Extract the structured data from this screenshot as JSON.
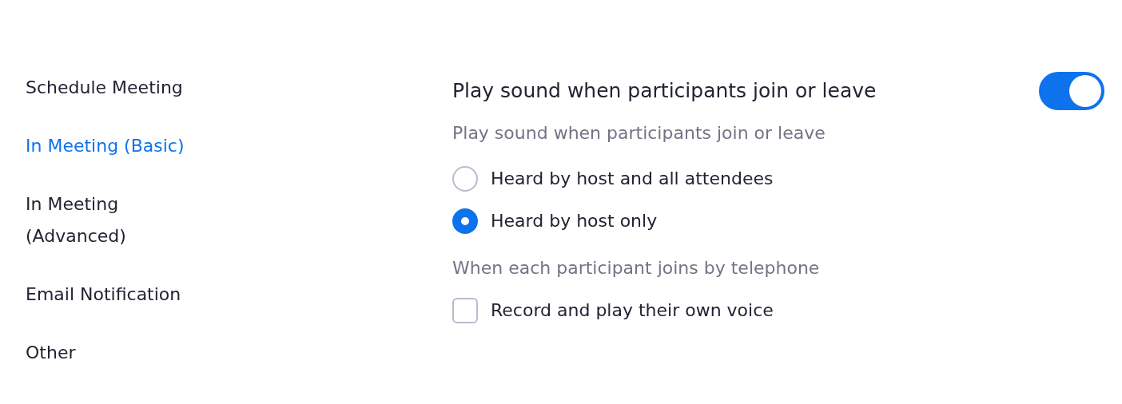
{
  "sidebar": {
    "items": [
      {
        "label": "Schedule Meeting",
        "selected": false
      },
      {
        "label": "In Meeting (Basic)",
        "selected": true
      },
      {
        "label": "In Meeting\n(Advanced)",
        "selected": false
      },
      {
        "label": "Email Notification",
        "selected": false
      },
      {
        "label": "Other",
        "selected": false
      }
    ]
  },
  "setting": {
    "title": "Play sound when participants join or leave",
    "on": true,
    "description": "Play sound when participants join or leave",
    "options": [
      {
        "kind": "radio",
        "label": "Heard by host and all attendees",
        "selected": false
      },
      {
        "kind": "radio",
        "label": "Heard by host only",
        "selected": true
      },
      {
        "kind": "heading",
        "label": "When each participant joins by telephone"
      },
      {
        "kind": "checkbox",
        "label": "Record and play their own voice",
        "checked": false
      }
    ]
  }
}
